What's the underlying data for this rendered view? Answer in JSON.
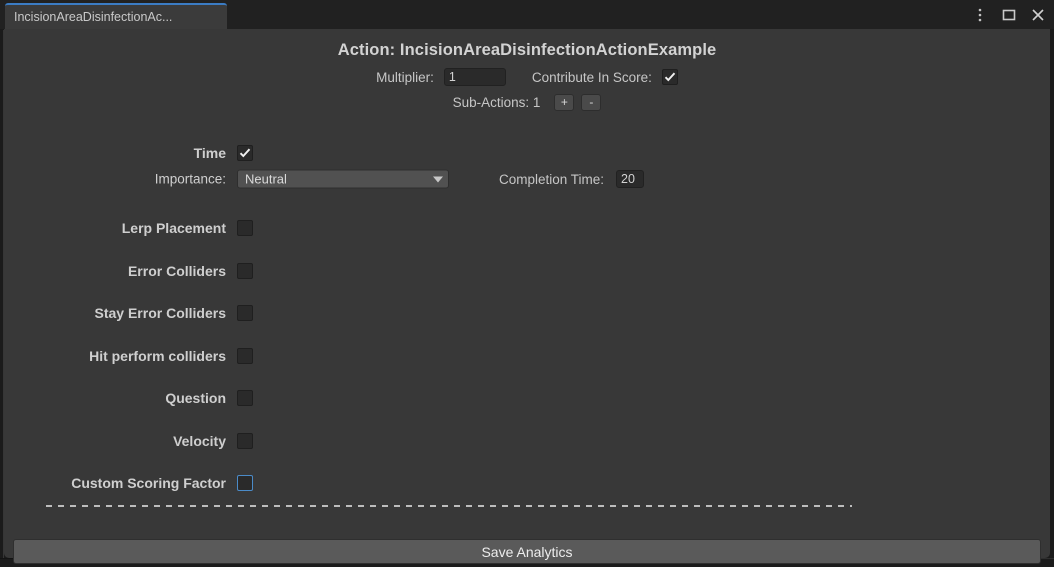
{
  "window": {
    "tab_label": "IncisionAreaDisinfectionAc...",
    "controls": [
      {
        "name": "more-options-icon",
        "label": "⋮"
      },
      {
        "name": "maximize-icon",
        "label": "□"
      },
      {
        "name": "close-icon",
        "label": "✕"
      }
    ]
  },
  "header": {
    "title": "Action: IncisionAreaDisinfectionActionExample"
  },
  "multiplier_row": {
    "label": "Multiplier:",
    "value": "1",
    "contribute_label": "Contribute In Score:",
    "contribute_checked": true
  },
  "sub_actions_row": {
    "label": "Sub-Actions: 1",
    "add_label": "+",
    "remove_label": "-"
  },
  "time_row": {
    "label": "Time",
    "checked": true
  },
  "importance_row": {
    "label": "Importance:",
    "selected": "Neutral",
    "options": [
      "Neutral"
    ],
    "completion_label": "Completion Time:",
    "completion_value": "20"
  },
  "toggles": [
    {
      "label": "Lerp Placement",
      "checked": false,
      "focused": false
    },
    {
      "label": "Error Colliders",
      "checked": false,
      "focused": false
    },
    {
      "label": "Stay Error Colliders",
      "checked": false,
      "focused": false
    },
    {
      "label": "Hit perform colliders",
      "checked": false,
      "focused": false
    },
    {
      "label": "Question",
      "checked": false,
      "focused": false
    },
    {
      "label": "Velocity",
      "checked": false,
      "focused": false
    },
    {
      "label": "Custom Scoring Factor",
      "checked": false,
      "focused": true
    }
  ],
  "footer": {
    "save_label": "Save Analytics"
  },
  "colors": {
    "panel_bg": "#383838",
    "tab_accent": "#3b7cc4",
    "focus_outline": "#4b8bc8",
    "text": "#cfcfcf",
    "button_bg": "#5a5a5a"
  }
}
